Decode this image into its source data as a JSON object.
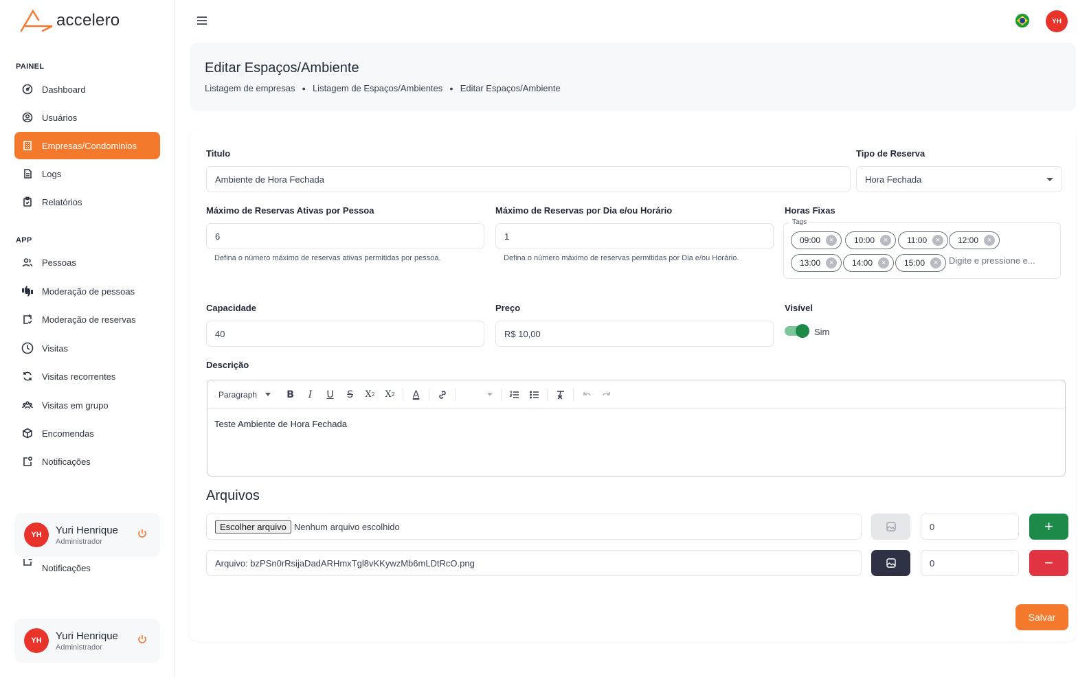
{
  "brand": {
    "name": "accelero",
    "accent": "#f5792c"
  },
  "sidebar": {
    "section_painel": "PAINEL",
    "section_app": "APP",
    "items_painel": [
      {
        "label": "Dashboard",
        "icon": "dashboard-icon"
      },
      {
        "label": "Usuários",
        "icon": "user-circle-icon"
      },
      {
        "label": "Empresas/Condominios",
        "icon": "building-icon",
        "active": true
      },
      {
        "label": "Logs",
        "icon": "file-icon"
      },
      {
        "label": "Relatórios",
        "icon": "clipboard-icon"
      }
    ],
    "items_app": [
      {
        "label": "Pessoas",
        "icon": "users-icon"
      },
      {
        "label": "Moderação de pessoas",
        "icon": "thumbs-icon"
      },
      {
        "label": "Moderação de reservas",
        "icon": "calendar-check-icon"
      },
      {
        "label": "Visitas",
        "icon": "clock-icon"
      },
      {
        "label": "Visitas recorrentes",
        "icon": "refresh-icon"
      },
      {
        "label": "Visitas em grupo",
        "icon": "group-icon"
      },
      {
        "label": "Encomendas",
        "icon": "package-icon"
      },
      {
        "label": "Notificações",
        "icon": "bell-icon"
      }
    ],
    "ghost_item": "Notificações",
    "user": {
      "initials": "YH",
      "name": "Yuri Henrique",
      "role": "Administrador"
    }
  },
  "topbar": {
    "avatar_initials": "YH",
    "flag": "brazil-flag-icon"
  },
  "header": {
    "title": "Editar Espaços/Ambiente",
    "breadcrumb": [
      "Listagem de empresas",
      "Listagem de Espaços/Ambientes",
      "Editar Espaços/Ambiente"
    ]
  },
  "form": {
    "titulo": {
      "label": "Titulo",
      "value": "Ambiente de Hora Fechada"
    },
    "tipo_reserva": {
      "label": "Tipo de Reserva",
      "value": "Hora Fechada"
    },
    "max_ativas": {
      "label": "Máximo de Reservas Ativas por Pessoa",
      "value": "6",
      "helper": "Defina o número máximo de reservas ativas permitidas por pessoa."
    },
    "max_dia": {
      "label": "Máximo de Reservas por Dia e/ou Horário",
      "value": "1",
      "helper": "Defina o número máximo de reservas permitidas por Dia e/ou Horário."
    },
    "horas_fixas": {
      "label": "Horas Fixas",
      "legend": "Tags",
      "tags": [
        "09:00",
        "10:00",
        "11:00",
        "12:00",
        "13:00",
        "14:00",
        "15:00"
      ],
      "placeholder": "Digite e pressione e..."
    },
    "capacidade": {
      "label": "Capacidade",
      "value": "40"
    },
    "preco": {
      "label": "Preço",
      "value": "R$ 10,00"
    },
    "visivel": {
      "label": "Visível",
      "value": "Sim",
      "on": true
    },
    "descricao": {
      "label": "Descrição",
      "paragraph": "Paragraph",
      "content": "Teste Ambiente de Hora Fechada"
    }
  },
  "arquivos": {
    "title": "Arquivos",
    "file_button": "Escolher arquivo",
    "no_file": "Nenhum arquivo escolhido",
    "existing_file": "Arquivo: bzPSn0rRsijaDadARHmxTgl8vKKywzMb6mLDtRcO.png",
    "order_1": "0",
    "order_2": "0",
    "add_color": "#1d8a4a",
    "remove_color": "#e03442"
  },
  "save_label": "Salvar"
}
